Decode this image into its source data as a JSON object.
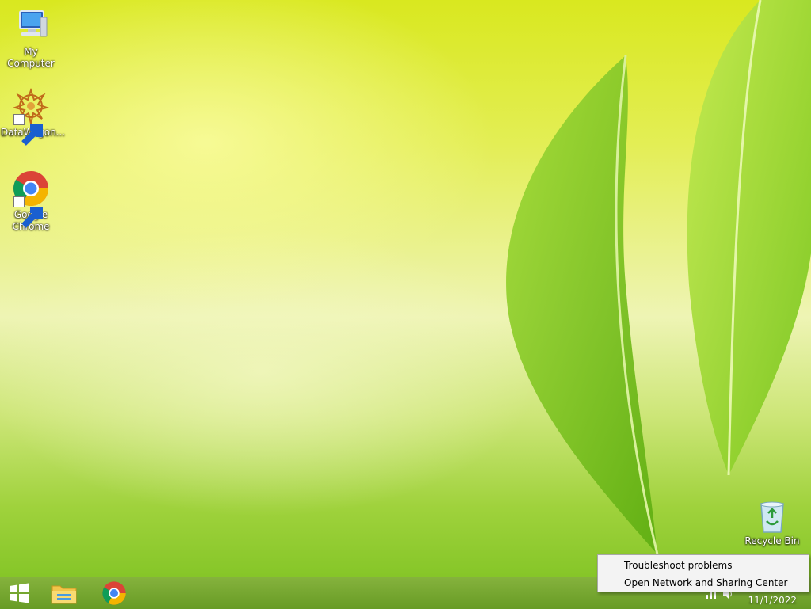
{
  "desktop": {
    "icons": [
      {
        "label": "My Computer",
        "icon": "computer-icon"
      },
      {
        "label": "DataWagon...",
        "icon": "datawagon-icon"
      },
      {
        "label": "Google Chrome",
        "icon": "chrome-icon"
      },
      {
        "label": "Recycle Bin",
        "icon": "recycle-bin-icon"
      }
    ]
  },
  "taskbar": {
    "start": {
      "icon": "windows-logo-icon"
    },
    "pinned": [
      {
        "icon": "file-explorer-icon"
      },
      {
        "icon": "chrome-icon"
      }
    ],
    "clock": {
      "date": "11/1/2022"
    }
  },
  "context_menu": {
    "items": [
      {
        "label": "Troubleshoot problems"
      },
      {
        "label": "Open Network and Sharing Center"
      }
    ]
  },
  "colors": {
    "taskbar": "#6a9e22",
    "menu_bg": "#f3f3f3",
    "leaf": "#7cc520"
  }
}
